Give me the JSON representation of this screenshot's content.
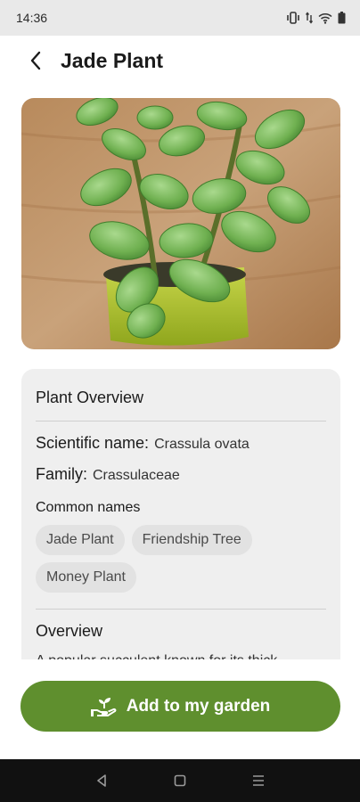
{
  "status_bar": {
    "time": "14:36",
    "icons": [
      "vibrate-icon",
      "data-arrows-icon",
      "wifi-icon",
      "battery-icon"
    ]
  },
  "header": {
    "title": "Jade Plant",
    "back_icon": "back-chevron-icon"
  },
  "hero_image": {
    "subject": "jade-plant-in-green-pot"
  },
  "overview_card": {
    "title": "Plant Overview",
    "scientific_label": "Scientific name:",
    "scientific_value": "Crassula ovata",
    "family_label": "Family:",
    "family_value": "Crassulaceae",
    "common_names_label": "Common names",
    "common_names": [
      "Jade Plant",
      "Friendship Tree",
      "Money Plant"
    ],
    "overview_heading": "Overview",
    "overview_text": "A popular succulent known for its thick"
  },
  "cta": {
    "label": "Add to my garden",
    "icon": "hand-plant-icon",
    "color": "#5f8f2e"
  },
  "nav_bar": {
    "icons": [
      "back-triangle-icon",
      "home-square-icon",
      "menu-lines-icon"
    ]
  }
}
